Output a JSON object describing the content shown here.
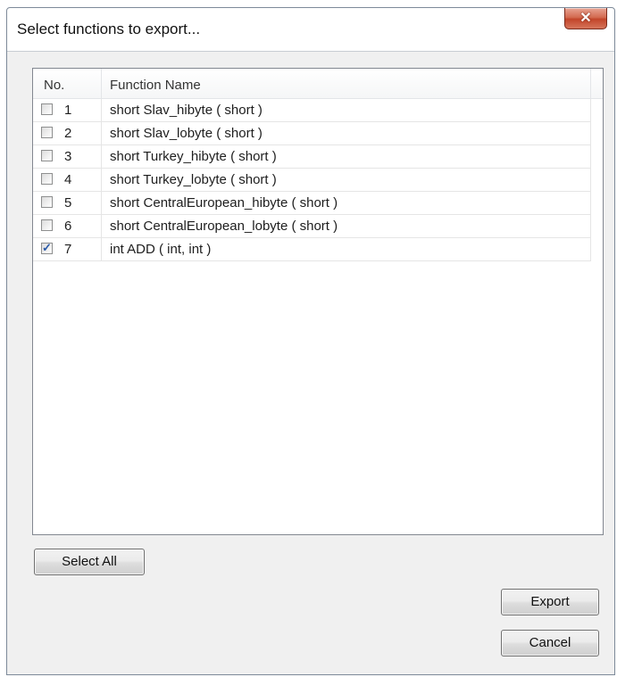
{
  "window": {
    "title": "Select functions to export...",
    "close_glyph": "✕"
  },
  "list": {
    "columns": [
      "No.",
      "Function Name"
    ],
    "rows": [
      {
        "no": "1",
        "name": "short Slav_hibyte ( short )",
        "checked": false
      },
      {
        "no": "2",
        "name": "short Slav_lobyte ( short )",
        "checked": false
      },
      {
        "no": "3",
        "name": "short Turkey_hibyte ( short )",
        "checked": false
      },
      {
        "no": "4",
        "name": "short Turkey_lobyte ( short )",
        "checked": false
      },
      {
        "no": "5",
        "name": "short CentralEuropean_hibyte ( short )",
        "checked": false
      },
      {
        "no": "6",
        "name": "short CentralEuropean_lobyte ( short )",
        "checked": false
      },
      {
        "no": "7",
        "name": "int ADD ( int, int )",
        "checked": true
      }
    ]
  },
  "buttons": {
    "select_all": "Select All",
    "export": "Export",
    "cancel": "Cancel"
  }
}
